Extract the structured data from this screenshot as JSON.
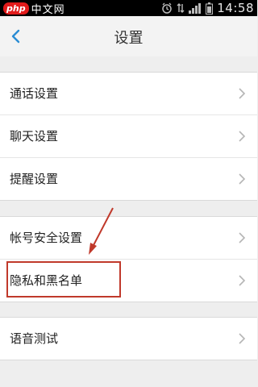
{
  "status_bar": {
    "logo_php": "php",
    "logo_site": "中文网",
    "time": "14:58"
  },
  "header": {
    "title": "设置"
  },
  "sections": [
    {
      "items": [
        "通话设置",
        "聊天设置",
        "提醒设置"
      ]
    },
    {
      "items": [
        "帐号安全设置",
        "隐私和黑名单"
      ]
    },
    {
      "items": [
        "语音测试"
      ]
    }
  ],
  "colors": {
    "accent": "#2a8dd4",
    "annotation": "#c0392b"
  }
}
